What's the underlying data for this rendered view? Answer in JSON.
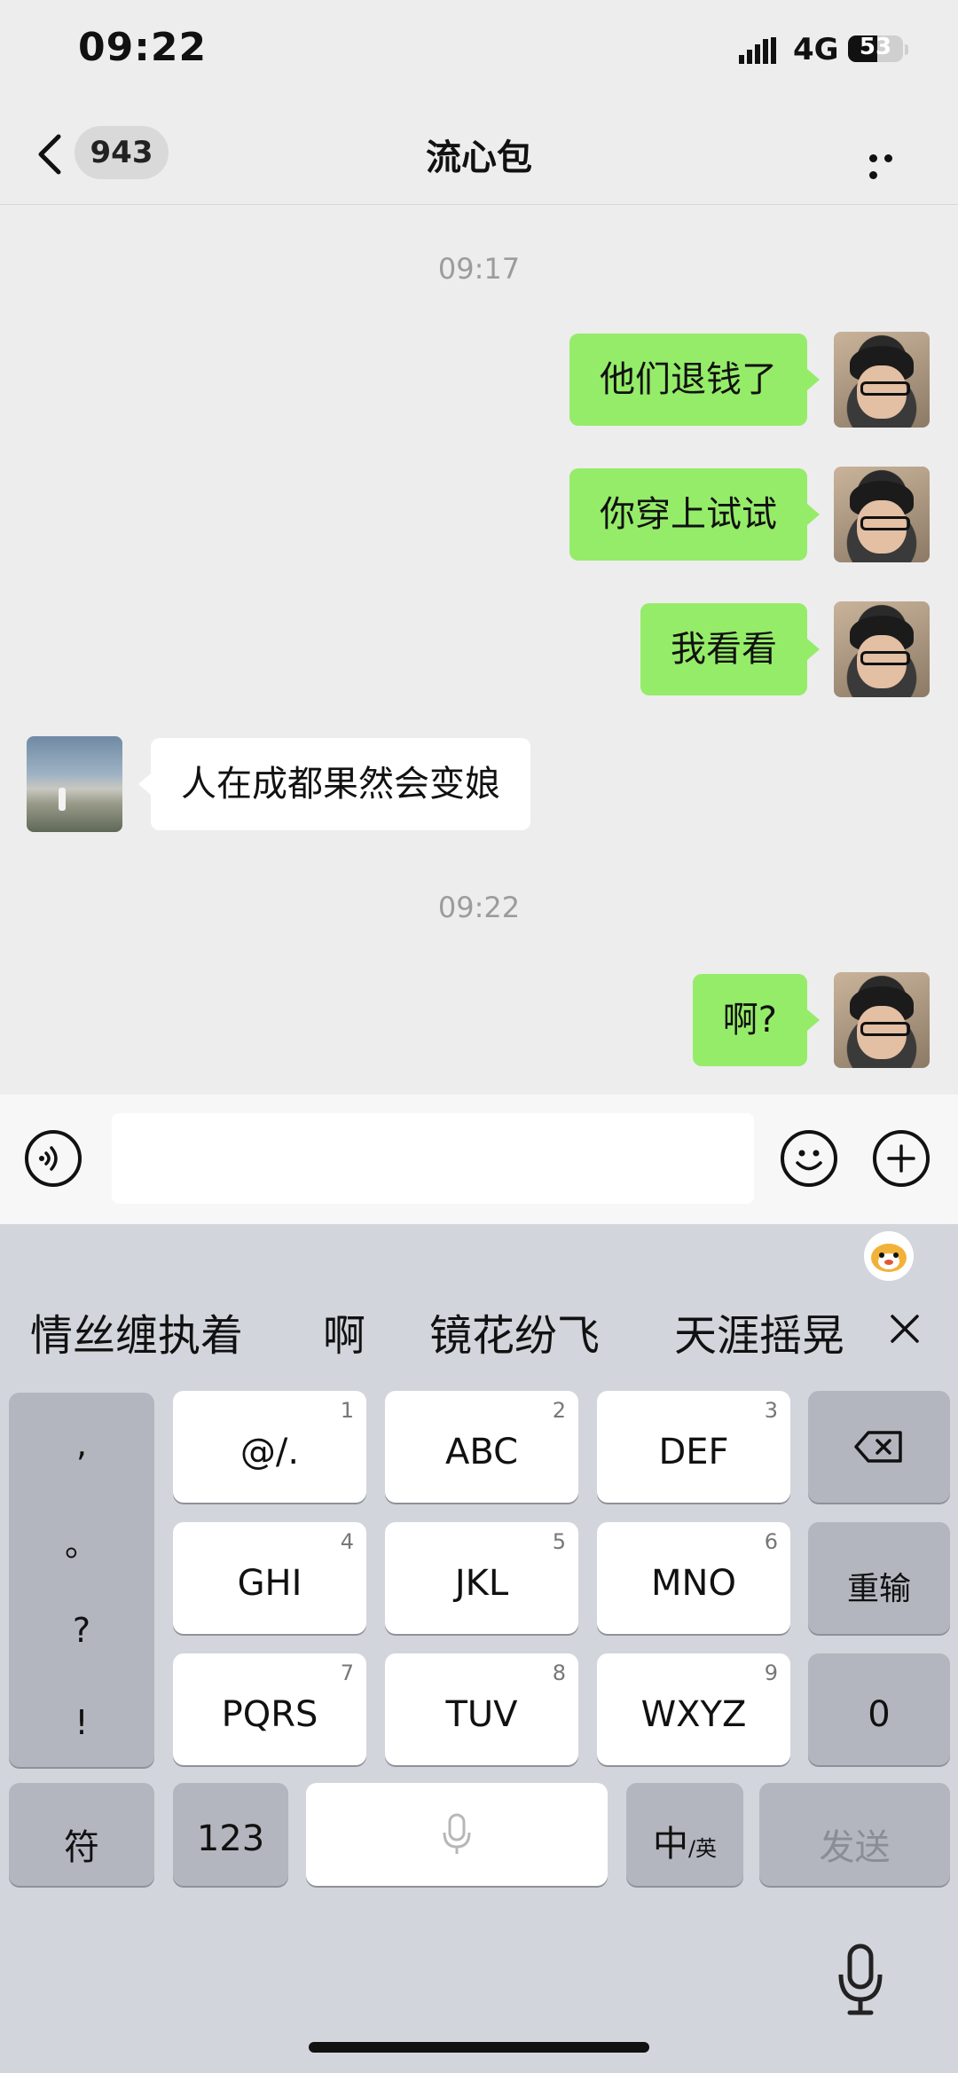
{
  "status_bar": {
    "time": "09:22",
    "network": "4G",
    "battery": "53",
    "battery_level": 0.53
  },
  "nav": {
    "back_icon": "chevron-left-icon",
    "unread_count": "943",
    "title": "流心包",
    "more_icon": "more-dots-icon"
  },
  "chat": {
    "timestamps": [
      "09:17",
      "09:22"
    ],
    "messages": [
      {
        "sender": "me",
        "text": "他们退钱了"
      },
      {
        "sender": "me",
        "text": "你穿上试试"
      },
      {
        "sender": "me",
        "text": "我看看"
      },
      {
        "sender": "peer",
        "text": "人在成都果然会变娘"
      },
      {
        "sender": "me",
        "text": "啊?"
      }
    ]
  },
  "input_bar": {
    "voice_icon": "voice-icon",
    "text_value": "",
    "emoji_icon": "emoji-icon",
    "plus_icon": "plus-icon"
  },
  "keyboard": {
    "candidates": [
      "情丝缠执着",
      "啊",
      "镜花纷飞",
      "天涯摇晃"
    ],
    "punct_keys": [
      ",",
      "。",
      "?",
      "!"
    ],
    "keys_row1": [
      {
        "num": "1",
        "label": "@/."
      },
      {
        "num": "2",
        "label": "ABC"
      },
      {
        "num": "3",
        "label": "DEF"
      }
    ],
    "keys_row2": [
      {
        "num": "4",
        "label": "GHI"
      },
      {
        "num": "5",
        "label": "JKL"
      },
      {
        "num": "6",
        "label": "MNO"
      }
    ],
    "keys_row3": [
      {
        "num": "7",
        "label": "PQRS"
      },
      {
        "num": "8",
        "label": "TUV"
      },
      {
        "num": "9",
        "label": "WXYZ"
      }
    ],
    "reinput_label": "重输",
    "zero_label": "0",
    "symbols_label": "符",
    "numbers_label": "123",
    "lang_main": "中",
    "lang_sub": "/英",
    "send_label": "发送"
  }
}
